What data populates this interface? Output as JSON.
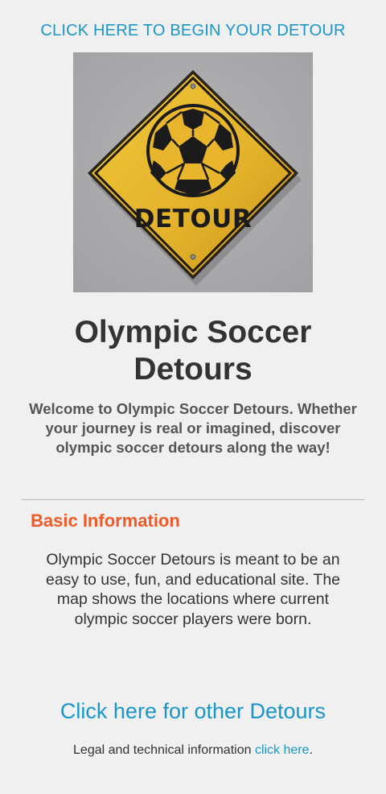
{
  "header": {
    "begin_link": "CLICK HERE TO BEGIN YOUR DETOUR"
  },
  "hero_image": {
    "sign_text": "DETOUR",
    "icon": "soccer-ball-detour-sign",
    "sign_color": "#e5b52b",
    "background_color": "#a9a9ab"
  },
  "main": {
    "title": "Olympic Soccer Detours",
    "welcome": "Welcome to Olympic Soccer Detours. Whether your journey is real or imagined, discover olympic soccer detours along the way!"
  },
  "basic_info": {
    "heading": "Basic Information",
    "body": "Olympic Soccer Detours is meant to be an easy to use, fun, and educational site. The map shows the locations where current olympic soccer players were born."
  },
  "footer": {
    "other_detours_link": "Click here for other Detours",
    "legal_prefix": "Legal and technical information ",
    "legal_link": "click here",
    "legal_suffix": "."
  },
  "colors": {
    "link": "#1a96c8",
    "heading_accent": "#f05a28",
    "background": "#f0f0f0"
  }
}
